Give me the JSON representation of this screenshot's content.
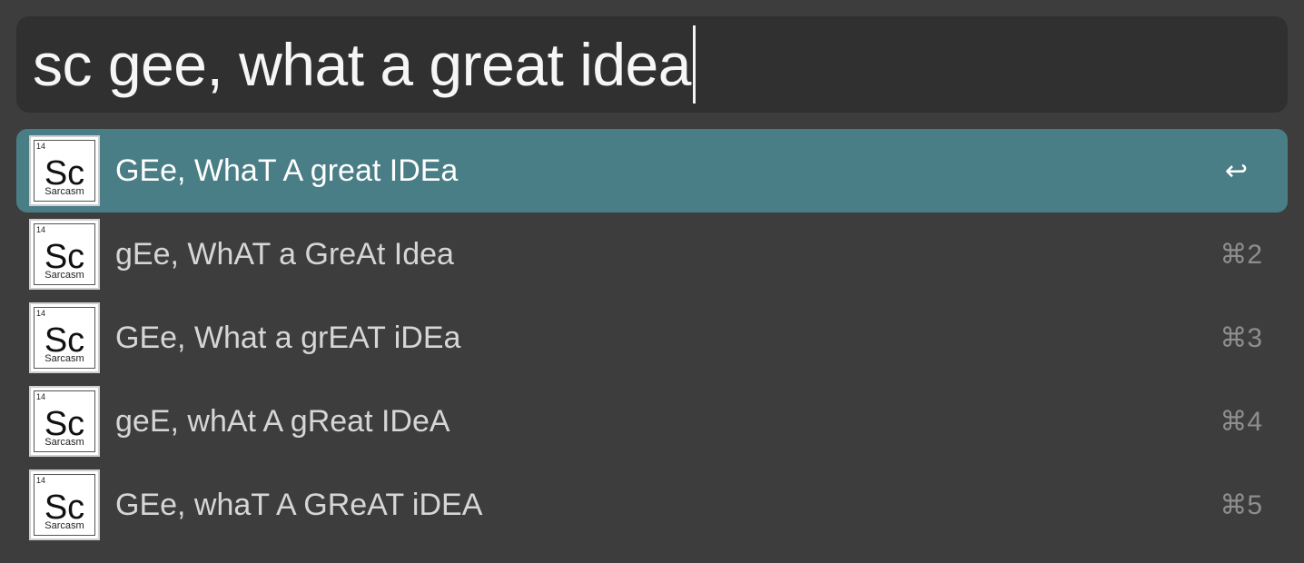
{
  "search": {
    "query": "sc gee, what a great idea"
  },
  "results": [
    {
      "icon": {
        "atomic_number": "14",
        "symbol": "Sc",
        "name": "Sarcasm"
      },
      "label": "GEe, WhaT A great IDEa",
      "shortcut": "↩",
      "selected": true
    },
    {
      "icon": {
        "atomic_number": "14",
        "symbol": "Sc",
        "name": "Sarcasm"
      },
      "label": "gEe, WhAT a GreAt Idea",
      "shortcut": "⌘2",
      "selected": false
    },
    {
      "icon": {
        "atomic_number": "14",
        "symbol": "Sc",
        "name": "Sarcasm"
      },
      "label": "GEe, What a grEAT iDEa",
      "shortcut": "⌘3",
      "selected": false
    },
    {
      "icon": {
        "atomic_number": "14",
        "symbol": "Sc",
        "name": "Sarcasm"
      },
      "label": "geE, whAt A gReat IDeA",
      "shortcut": "⌘4",
      "selected": false
    },
    {
      "icon": {
        "atomic_number": "14",
        "symbol": "Sc",
        "name": "Sarcasm"
      },
      "label": "GEe, whaT A GReAT iDEA",
      "shortcut": "⌘5",
      "selected": false
    }
  ],
  "colors": {
    "window_bg": "#3c3d3c",
    "search_bg": "#2f302f",
    "selected_bg": "#4a7e86"
  }
}
